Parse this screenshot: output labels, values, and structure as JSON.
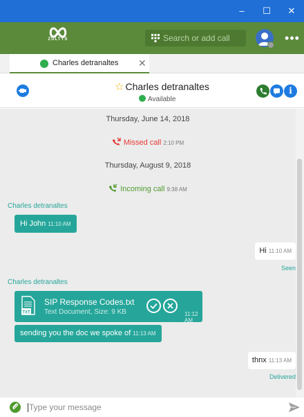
{
  "window": {
    "minimize_symbol": "–",
    "maximize_symbol": "☐",
    "close_symbol": "✕"
  },
  "app": {
    "logo_text": "ZULTYS",
    "search_placeholder": "Search or add call",
    "more_symbol": "•••",
    "accent_color": "#5b8a3a"
  },
  "tab": {
    "label": "Charles detranaltes",
    "close_symbol": "✕"
  },
  "contact": {
    "name": "Charles detranaltes",
    "status": "Available",
    "info_symbol": "i"
  },
  "chat": {
    "events": [
      {
        "date": "Thursday, June 14, 2018",
        "label": "Missed call",
        "time": "2:10 PM"
      },
      {
        "date": "Thursday, August 9, 2018",
        "label": "Incoming call",
        "time": "9:38 AM"
      }
    ],
    "sender_1": "Charles detranaltes",
    "msg_1": {
      "text": "Hi John",
      "time": "11:10 AM"
    },
    "msg_2": {
      "text": "Hi",
      "time": "11:10 AM",
      "receipt": "Seen"
    },
    "sender_2": "Charles detranaltes",
    "file": {
      "name": "SIP Response Codes.txt",
      "meta": "Text Document, Size: 9 KB",
      "time": "11:12 AM",
      "icon_label": "TXT"
    },
    "msg_3": {
      "text": "sending you the doc we spoke of",
      "time": "11:13 AM"
    },
    "msg_4": {
      "text": "thnx",
      "time": "11:13 AM",
      "receipt": "Delivered"
    }
  },
  "composer": {
    "placeholder": "Type your message"
  }
}
